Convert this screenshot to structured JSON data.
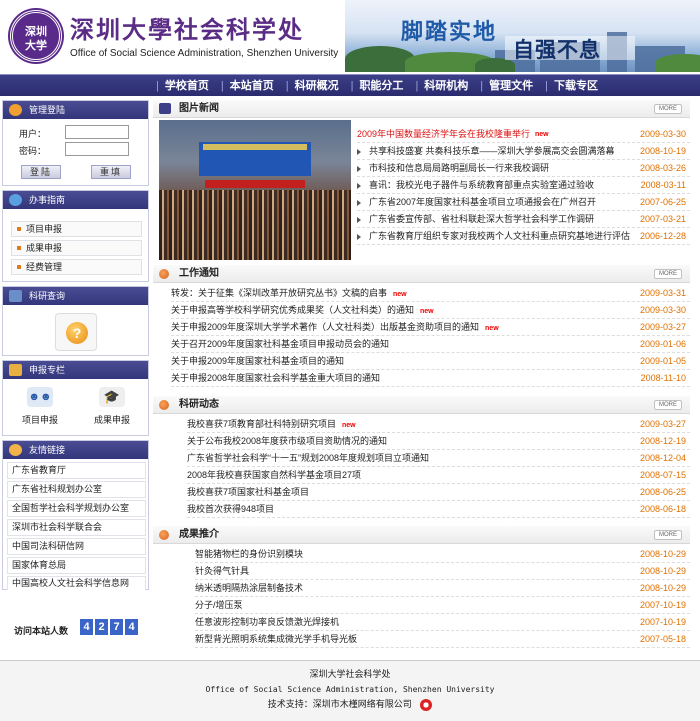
{
  "header": {
    "seal_text": "深圳\n大学",
    "title_cn": "深圳大學社会科学处",
    "title_en": "Office of Social Science Administration, Shenzhen University",
    "slogan_1": "脚踏实地",
    "slogan_2": "自强不息"
  },
  "nav": {
    "items": [
      "学校首页",
      "本站首页",
      "科研概况",
      "职能分工",
      "科研机构",
      "管理文件",
      "下载专区"
    ]
  },
  "sidebar": {
    "login": {
      "title": "管理登陆",
      "user_label": "用户：",
      "password_label": "密码：",
      "login_button": "登陆",
      "reset_button": "重填"
    },
    "guide": {
      "title": "办事指南",
      "items": [
        "项目申报",
        "成果申报",
        "经费管理"
      ]
    },
    "query": {
      "title": "科研查询"
    },
    "declare": {
      "title": "申报专栏",
      "items": [
        "项目申报",
        "成果申报"
      ]
    },
    "links": {
      "title": "友情链接",
      "items": [
        "广东省教育厅",
        "广东省社科规划办公室",
        "全国哲学社会科学规划办公室",
        "深圳市社会科学联合会",
        "中国司法科研信网",
        "国家体育总局",
        "中国高校人文社会科学信息网"
      ]
    },
    "visitors": {
      "label": "访问本站人数",
      "digits": [
        "4",
        "2",
        "7",
        "4"
      ]
    }
  },
  "sections": {
    "photo_news": {
      "title": "图片新闻",
      "more": "MORE",
      "items": [
        {
          "text": "2009年中国数量经济学年会在我校隆重举行",
          "new": "new",
          "date": "2009-03-30",
          "highlight": true
        },
        {
          "text": "共享科技盛宴 共奏科技乐章——深圳大学参展高交会圆满落幕",
          "new": "",
          "date": "2008-10-19"
        },
        {
          "text": "市科技和信息局局路明副局长一行来我校调研",
          "new": "",
          "date": "2008-03-26"
        },
        {
          "text": "喜讯：我校光电子器件与系统教育部重点实验室通过验收",
          "new": "",
          "date": "2008-03-11"
        },
        {
          "text": "广东省2007年度国家社科基金项目立项通报会在广州召开",
          "new": "",
          "date": "2007-06-25"
        },
        {
          "text": "广东省委宣传部、省社科联赴深大哲学社会科学工作调研",
          "new": "",
          "date": "2007-03-21"
        },
        {
          "text": "广东省教育厅组织专家对我校两个人文社科重点研究基地进行评估",
          "new": "",
          "date": "2006-12-28"
        }
      ]
    },
    "work_notice": {
      "title": "工作通知",
      "more": "MORE",
      "items": [
        {
          "text": "转发：关于征集《深圳改革开放研究丛书》文稿的启事",
          "new": "new",
          "date": "2009-03-31"
        },
        {
          "text": "关于申报高等学校科学研究优秀成果奖（人文社科类）的通知",
          "new": "new",
          "date": "2009-03-30"
        },
        {
          "text": "关于申报2009年度深圳大学学术著作（人文社科类）出版基金资助项目的通知",
          "new": "new",
          "date": "2009-03-27"
        },
        {
          "text": "关于召开2009年度国家社科基金项目申报动员会的通知",
          "new": "",
          "date": "2009-01-06"
        },
        {
          "text": "关于申报2009年度国家社科基金项目的通知",
          "new": "",
          "date": "2009-01-05"
        },
        {
          "text": "关于申报2008年度国家社会科学基金重大项目的通知",
          "new": "",
          "date": "2008-11-10"
        }
      ]
    },
    "research_news": {
      "title": "科研动态",
      "more": "MORE",
      "items": [
        {
          "text": "我校喜获7项教育部社科特别研究项目",
          "new": "new",
          "date": "2009-03-27"
        },
        {
          "text": "关于公布我校2008年度获市级项目资助情况的通知",
          "new": "",
          "date": "2008-12-19"
        },
        {
          "text": "广东省哲学社会科学“十一五”规划2008年度规划项目立项通知",
          "new": "",
          "date": "2008-12-04"
        },
        {
          "text": "2008年我校喜获国家自然科学基金项目27项",
          "new": "",
          "date": "2008-07-15"
        },
        {
          "text": "我校喜获7项国家社科基金项目",
          "new": "",
          "date": "2008-06-25"
        },
        {
          "text": "我校首次获得948项目",
          "new": "",
          "date": "2008-06-18"
        }
      ]
    },
    "achievements": {
      "title": "成果推介",
      "more": "MORE",
      "items": [
        {
          "text": "智能猪物栏的身份识别模块",
          "new": "",
          "date": "2008-10-29"
        },
        {
          "text": "针灸得气针具",
          "new": "",
          "date": "2008-10-29"
        },
        {
          "text": "纳米透明隔热涂层制备技术",
          "new": "",
          "date": "2008-10-29"
        },
        {
          "text": "分子/增压泵",
          "new": "",
          "date": "2007-10-19"
        },
        {
          "text": "任意波形控制功率良反馈激光焊接机",
          "new": "",
          "date": "2007-10-19"
        },
        {
          "text": "新型背光照明系统集成微光学手机导光板",
          "new": "",
          "date": "2007-05-18"
        }
      ]
    }
  },
  "footer": {
    "line_1": "深圳大学社会科学处",
    "line_2": "Office of Social Science Administration, Shenzhen University",
    "line_3": "技术支持：深圳市木槿网络有限公司"
  },
  "colors": {
    "nav_bg": "#2a2c6e",
    "accent_orange": "#e07000",
    "new_red": "#e00000",
    "title_purple": "#5b2c86"
  }
}
